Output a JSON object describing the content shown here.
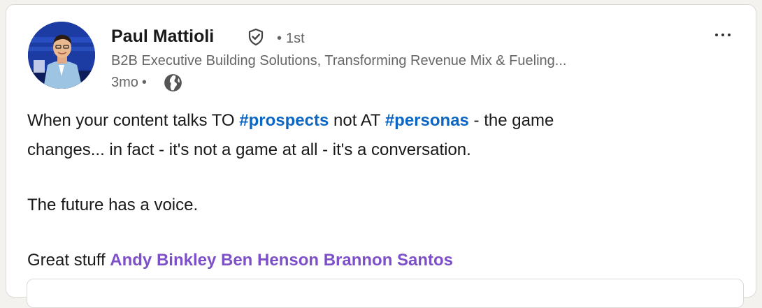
{
  "post": {
    "author": {
      "name": "Paul Mattioli",
      "degree_separator": "•",
      "degree": "1st",
      "headline": "B2B Executive Building Solutions, Transforming Revenue Mix & Fueling...",
      "time": "3mo",
      "time_separator": "•"
    },
    "body": {
      "line1": {
        "part1": "When your content talks TO ",
        "hashtag1": "#prospects",
        "part2": " not AT ",
        "hashtag2": "#personas",
        "part3": " - the game"
      },
      "line2": "changes... in fact - it's not a game at all - it's a conversation.",
      "line3": "The future has a voice.",
      "line4": {
        "prefix": "Great stuff ",
        "mentions": [
          "Andy Binkley",
          "Ben Henson",
          "Brannon Santos"
        ]
      }
    },
    "icons": {
      "verified": "shield-check-icon",
      "visibility": "globe-icon",
      "menu": "ellipsis-icon"
    },
    "colors": {
      "hashtag": "#0a66c2",
      "mention": "#7d4fc8",
      "text": "#191919",
      "secondary_text": "#666666"
    }
  }
}
